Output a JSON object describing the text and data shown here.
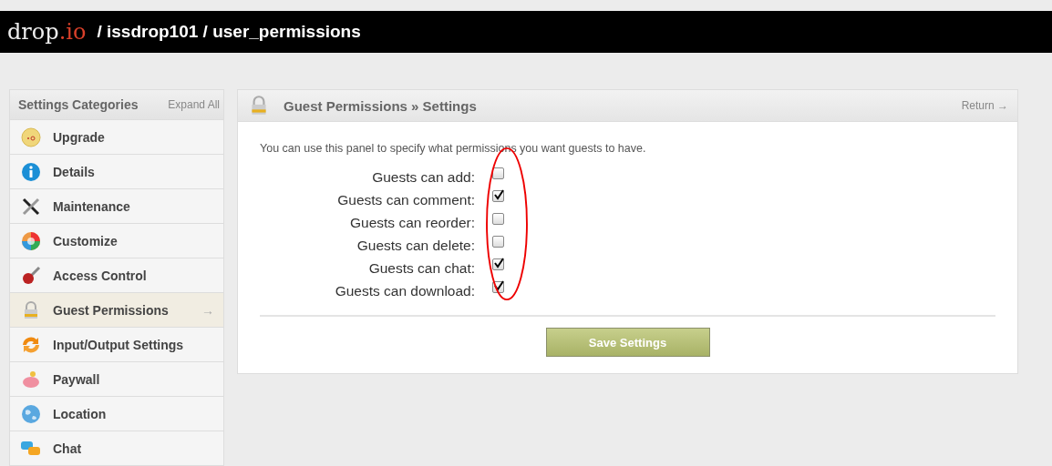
{
  "header": {
    "logo": {
      "name": "drop",
      "suffix": ".io"
    },
    "breadcrumb": "/ issdrop101 / user_permissions"
  },
  "sidebar": {
    "title": "Settings Categories",
    "expand": "Expand All",
    "items": [
      {
        "label": "Upgrade",
        "selected": false
      },
      {
        "label": "Details",
        "selected": false
      },
      {
        "label": "Maintenance",
        "selected": false
      },
      {
        "label": "Customize",
        "selected": false
      },
      {
        "label": "Access Control",
        "selected": false
      },
      {
        "label": "Guest Permissions",
        "selected": true,
        "arrow": "→"
      },
      {
        "label": "Input/Output Settings",
        "selected": false
      },
      {
        "label": "Paywall",
        "selected": false
      },
      {
        "label": "Location",
        "selected": false
      },
      {
        "label": "Chat",
        "selected": false
      }
    ]
  },
  "panel": {
    "title": "Guest Permissions » Settings",
    "return": "Return →",
    "intro": "You can use this panel to specify what permissions you want guests to have.",
    "permissions": [
      {
        "label": "Guests can add:",
        "checked": false
      },
      {
        "label": "Guests can comment:",
        "checked": true
      },
      {
        "label": "Guests can reorder:",
        "checked": false
      },
      {
        "label": "Guests can delete:",
        "checked": false
      },
      {
        "label": "Guests can chat:",
        "checked": true
      },
      {
        "label": "Guests can download:",
        "checked": true
      }
    ],
    "save": "Save Settings"
  }
}
